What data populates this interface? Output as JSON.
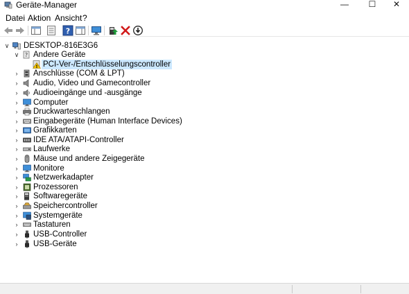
{
  "window": {
    "title": "Geräte-Manager",
    "min_glyph": "—",
    "max_glyph": "☐",
    "close_glyph": "✕"
  },
  "menu": {
    "items": [
      "Datei",
      "Aktion",
      "Ansicht",
      "?"
    ]
  },
  "toolbar": {
    "buttons": [
      "back-icon",
      "forward-icon",
      "show-hide-tree-icon",
      "properties-icon",
      "help-icon",
      "action-pane-icon",
      "monitor-scan-icon",
      "update-driver-icon",
      "uninstall-icon",
      "disable-icon"
    ]
  },
  "tree": {
    "root": "DESKTOP-816E3G6",
    "open_group": "Andere Geräte",
    "open_child": "PCI-Ver-/Entschlüsselungscontroller",
    "categories": [
      "Anschlüsse (COM & LPT)",
      "Audio, Video und Gamecontroller",
      "Audioeingänge und -ausgänge",
      "Computer",
      "Druckwarteschlangen",
      "Eingabegeräte (Human Interface Devices)",
      "Grafikkarten",
      "IDE ATA/ATAPI-Controller",
      "Laufwerke",
      "Mäuse und andere Zeigegeräte",
      "Monitore",
      "Netzwerkadapter",
      "Prozessoren",
      "Softwaregeräte",
      "Speichercontroller",
      "Systemgeräte",
      "Tastaturen",
      "USB-Controller",
      "USB-Geräte"
    ]
  },
  "colors": {
    "selection": "#cce8ff",
    "error_red": "#d11a1a",
    "warning_yellow": "#f5c400",
    "accent_blue": "#1f6fc5"
  }
}
